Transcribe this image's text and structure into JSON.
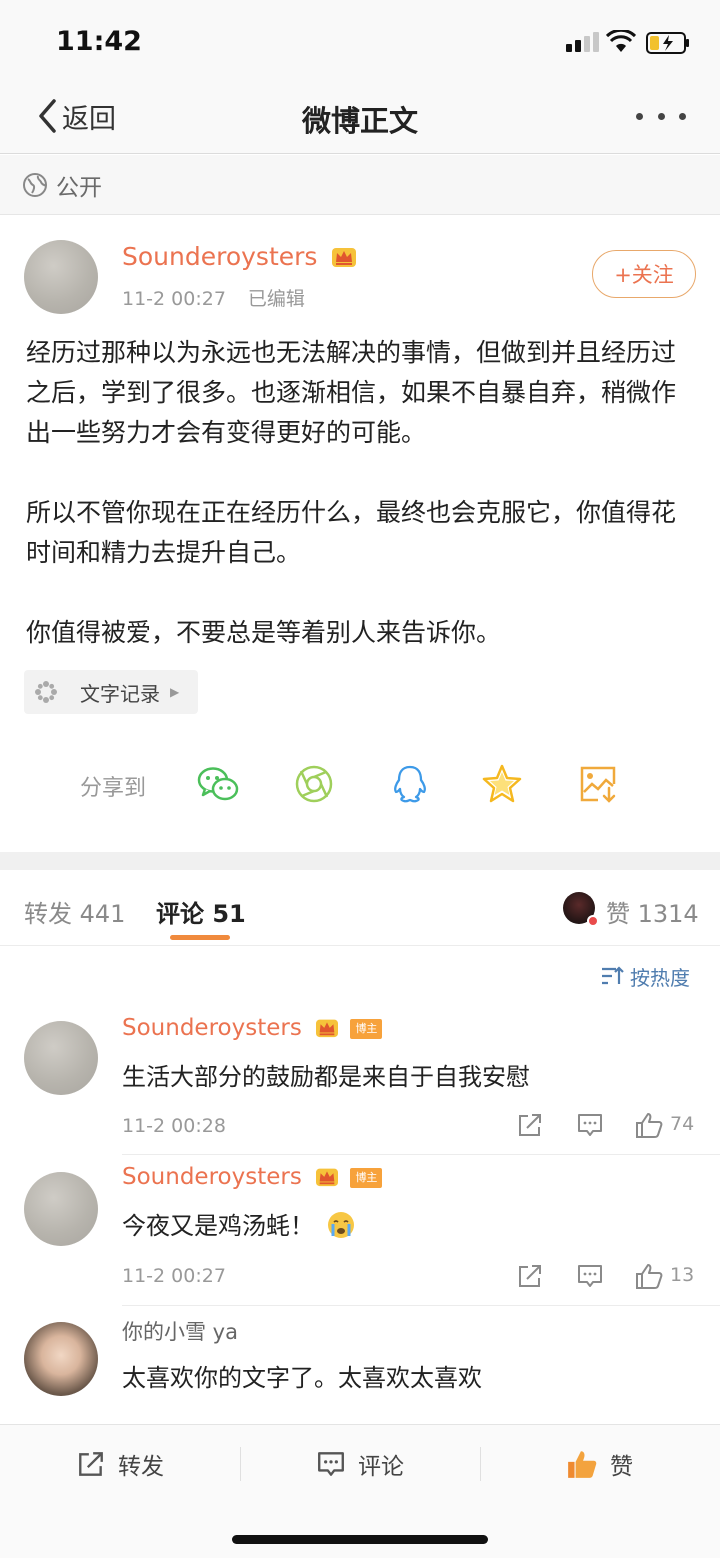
{
  "status_bar": {
    "time": "11:42"
  },
  "nav": {
    "back_label": "返回",
    "title": "微博正文"
  },
  "visibility": {
    "label": "公开"
  },
  "post": {
    "author": "Sounderoysters",
    "time": "11-2 00:27",
    "edited": "已编辑",
    "follow_label": "+关注",
    "paragraphs": [
      "经历过那种以为永远也无法解决的事情，但做到并且经历过之后，学到了很多。也逐渐相信，如果不自暴自弃，稍微作出一些努力才会有变得更好的可能。",
      "所以不管你现在正在经历什么，最终也会克服它，你值得花时间和精力去提升自己。",
      "你值得被爱，不要总是等着别人来告诉你。"
    ],
    "topic_label": "文字记录"
  },
  "share": {
    "label": "分享到",
    "icons": [
      "wechat-icon",
      "moments-icon",
      "qq-icon",
      "favorite-star-icon",
      "save-image-icon"
    ]
  },
  "tabs": {
    "repost": "转发 441",
    "comments": "评论 51",
    "likes": "赞 1314"
  },
  "sort": {
    "label": "按热度"
  },
  "comments": [
    {
      "name": "Sounderoysters",
      "badge": "博主",
      "text": "生活大部分的鼓励都是来自于自我安慰",
      "time": "11-2 00:28",
      "likes": "74"
    },
    {
      "name": "Sounderoysters",
      "badge": "博主",
      "text": "今夜又是鸡汤蚝！",
      "emoji": "crying-face-emoji",
      "time": "11-2 00:27",
      "likes": "13"
    },
    {
      "name": "你的小雪 ya",
      "text": "太喜欢你的文字了。太喜欢太喜欢"
    }
  ],
  "bottom_bar": {
    "repost": "转发",
    "comment": "评论",
    "like": "赞"
  },
  "colors": {
    "accent": "#eb7350",
    "link_blue": "#507daf",
    "tab_underline": "#f08a3d"
  }
}
